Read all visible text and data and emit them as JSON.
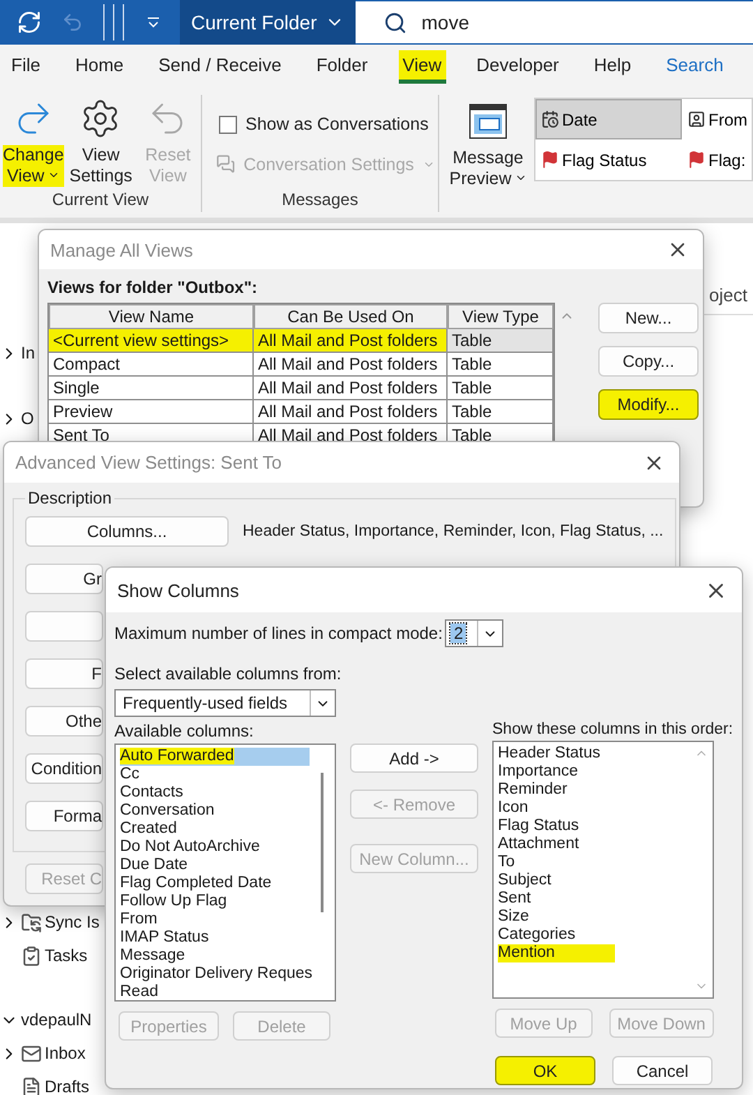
{
  "title_bar": {
    "scope": "Current Folder",
    "search": "move"
  },
  "menu_tabs": [
    {
      "label": "File",
      "selected": false,
      "highlighted": false,
      "kind": "normal"
    },
    {
      "label": "Home",
      "selected": false,
      "highlighted": false,
      "kind": "normal"
    },
    {
      "label": "Send / Receive",
      "selected": false,
      "highlighted": false,
      "kind": "normal"
    },
    {
      "label": "Folder",
      "selected": false,
      "highlighted": false,
      "kind": "normal"
    },
    {
      "label": "View",
      "selected": true,
      "highlighted": true,
      "kind": "normal"
    },
    {
      "label": "Developer",
      "selected": false,
      "highlighted": false,
      "kind": "normal"
    },
    {
      "label": "Help",
      "selected": false,
      "highlighted": false,
      "kind": "normal"
    },
    {
      "label": "Search",
      "selected": false,
      "highlighted": false,
      "kind": "contextual"
    }
  ],
  "ribbon": {
    "current_view": {
      "label": "Current View",
      "buttons": [
        {
          "label": "Change View",
          "dropdown": true,
          "disabled": false,
          "highlighted": true
        },
        {
          "label": "View Settings",
          "dropdown": false,
          "disabled": false,
          "highlighted": false
        },
        {
          "label": "Reset View",
          "dropdown": false,
          "disabled": true,
          "highlighted": false
        }
      ]
    },
    "messages": {
      "label": "Messages",
      "show_as_conversations": {
        "label": "Show as Conversations",
        "checked": false
      },
      "conversation_settings": {
        "label": "Conversation Settings",
        "disabled": true
      }
    },
    "arrangement": {
      "message_preview": "Message Preview",
      "items": [
        {
          "label": "Date",
          "selected": true
        },
        {
          "label": "From",
          "selected": false
        },
        {
          "label": "Flag Status",
          "selected": false
        },
        {
          "label": "Flag:",
          "selected": false
        }
      ]
    }
  },
  "folder_pane": {
    "upper": [
      {
        "label": "In",
        "expanded": false
      },
      {
        "label": "O",
        "expanded": false
      }
    ],
    "lower": [
      {
        "label": "Sync Is",
        "expanded": false
      },
      {
        "label": "Tasks"
      },
      {
        "label": "vdepaulN",
        "expanded": true
      },
      {
        "label": "Inbox",
        "expanded": false
      },
      {
        "label": "Drafts"
      }
    ]
  },
  "message_list": {
    "column_header": "oject"
  },
  "manage_views": {
    "title": "Manage All Views",
    "folder_label": "Views for folder \"Outbox\":",
    "columns": [
      "View Name",
      "Can Be Used On",
      "View Type"
    ],
    "rows": [
      {
        "cells": [
          "<Current view settings>",
          "All Mail and Post folders",
          "Table"
        ],
        "selected": true,
        "highlighted": true
      },
      {
        "cells": [
          "Compact",
          "All Mail and Post folders",
          "Table"
        ],
        "selected": false,
        "highlighted": false
      },
      {
        "cells": [
          "Single",
          "All Mail and Post folders",
          "Table"
        ],
        "selected": false,
        "highlighted": false
      },
      {
        "cells": [
          "Preview",
          "All Mail and Post folders",
          "Table"
        ],
        "selected": false,
        "highlighted": false
      },
      {
        "cells": [
          "Sent To",
          "All Mail and Post folders",
          "Table"
        ],
        "selected": false,
        "highlighted": false
      }
    ],
    "buttons": [
      {
        "label": "New...",
        "highlighted": false
      },
      {
        "label": "Copy...",
        "highlighted": false
      },
      {
        "label": "Modify...",
        "highlighted": true
      }
    ]
  },
  "advanced_view_settings": {
    "title": "Advanced View Settings: Sent To",
    "group_label": "Description",
    "columns_button": "Columns...",
    "columns_summary": "Header Status, Importance, Reminder, Icon, Flag Status, ...",
    "buttons": [
      {
        "kind": "labeled",
        "label": "Gr"
      },
      {
        "kind": "blank"
      },
      {
        "kind": "labeled",
        "label": "F"
      },
      {
        "kind": "labeled",
        "label": "Othe"
      },
      {
        "kind": "labeled",
        "label": "Condition"
      },
      {
        "kind": "labeled",
        "label": "Forma"
      }
    ],
    "reset_button": {
      "label": "Reset C",
      "disabled": true
    }
  },
  "show_columns": {
    "title": "Show Columns",
    "max_lines_label": "Maximum number of lines in compact mode:",
    "max_lines_value": "2",
    "source_label": "Select available columns from:",
    "source_value": "Frequently-used fields",
    "available_label": "Available columns:",
    "available": [
      {
        "label": "Auto Forwarded",
        "selected": true,
        "highlighted": true
      },
      {
        "label": "Cc",
        "selected": false,
        "highlighted": false
      },
      {
        "label": "Contacts",
        "selected": false,
        "highlighted": false
      },
      {
        "label": "Conversation",
        "selected": false,
        "highlighted": false
      },
      {
        "label": "Created",
        "selected": false,
        "highlighted": false
      },
      {
        "label": "Do Not AutoArchive",
        "selected": false,
        "highlighted": false
      },
      {
        "label": "Due Date",
        "selected": false,
        "highlighted": false
      },
      {
        "label": "Flag Completed Date",
        "selected": false,
        "highlighted": false
      },
      {
        "label": "Follow Up Flag",
        "selected": false,
        "highlighted": false
      },
      {
        "label": "From",
        "selected": false,
        "highlighted": false
      },
      {
        "label": "IMAP Status",
        "selected": false,
        "highlighted": false
      },
      {
        "label": "Message",
        "selected": false,
        "highlighted": false
      },
      {
        "label": "Originator Delivery Reques",
        "selected": false,
        "highlighted": false
      },
      {
        "label": "Read",
        "selected": false,
        "highlighted": false
      }
    ],
    "middle_buttons": [
      {
        "label": "Add ->",
        "disabled": false
      },
      {
        "label": "<- Remove",
        "disabled": true
      },
      {
        "label": "New Column...",
        "disabled": true
      }
    ],
    "shown_label": "Show these columns in this order:",
    "shown": [
      {
        "label": "Header Status",
        "highlighted": false
      },
      {
        "label": "Importance",
        "highlighted": false
      },
      {
        "label": "Reminder",
        "highlighted": false
      },
      {
        "label": "Icon",
        "highlighted": false
      },
      {
        "label": "Flag Status",
        "highlighted": false
      },
      {
        "label": "Attachment",
        "highlighted": false
      },
      {
        "label": "To",
        "highlighted": false
      },
      {
        "label": "Subject",
        "highlighted": false
      },
      {
        "label": "Sent",
        "highlighted": false
      },
      {
        "label": "Size",
        "highlighted": false
      },
      {
        "label": "Categories",
        "highlighted": false
      },
      {
        "label": "Mention",
        "highlighted": true
      }
    ],
    "list_buttons": [
      {
        "label": "Properties",
        "disabled": true
      },
      {
        "label": "Delete",
        "disabled": true
      }
    ],
    "order_buttons": [
      {
        "label": "Move Up",
        "disabled": true
      },
      {
        "label": "Move Down",
        "disabled": true
      }
    ],
    "dialog_buttons": [
      {
        "label": "OK",
        "highlighted": true
      },
      {
        "label": "Cancel",
        "highlighted": false
      }
    ]
  }
}
